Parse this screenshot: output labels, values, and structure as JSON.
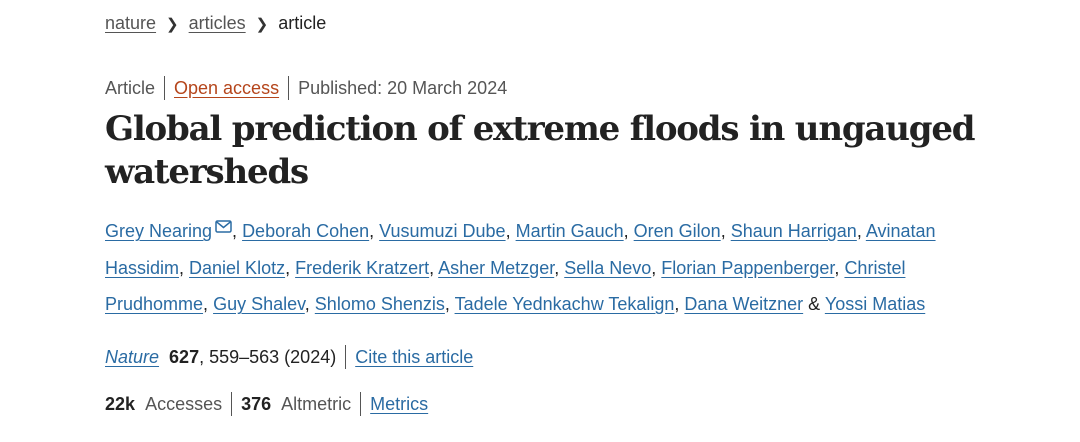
{
  "breadcrumb": {
    "items": [
      "nature",
      "articles"
    ],
    "current": "article"
  },
  "meta": {
    "type": "Article",
    "open_access": "Open access",
    "published": "Published: 20 March 2024"
  },
  "title": "Global prediction of extreme floods in ungauged watersheds",
  "authors": [
    "Grey Nearing",
    "Deborah Cohen",
    "Vusumuzi Dube",
    "Martin Gauch",
    "Oren Gilon",
    "Shaun Harrigan",
    "Avinatan Hassidim",
    "Daniel Klotz",
    "Frederik Kratzert",
    "Asher Metzger",
    "Sella Nevo",
    "Florian Pappenberger",
    "Christel Prudhomme",
    "Guy Shalev",
    "Shlomo Shenzis",
    "Tadele Yednkachw Tekalign",
    "Dana Weitzner",
    "Yossi Matias"
  ],
  "authors_separator": ", ",
  "authors_last_joiner": " & ",
  "citation": {
    "journal": "Nature",
    "volume": "627",
    "pages_year": ", 559–563 (2024)",
    "cite_link": "Cite this article"
  },
  "metrics": {
    "accesses_count": "22k",
    "accesses_label": "Accesses",
    "altmetric_count": "376",
    "altmetric_label": "Altmetric",
    "metrics_link": "Metrics"
  },
  "icons": {
    "breadcrumb_separator": "chevron-right-icon",
    "corresponding_author": "mail-icon"
  },
  "colors": {
    "link": "#2a6ba3",
    "open_access": "#b5451b",
    "text": "#222222",
    "muted": "#555555"
  }
}
